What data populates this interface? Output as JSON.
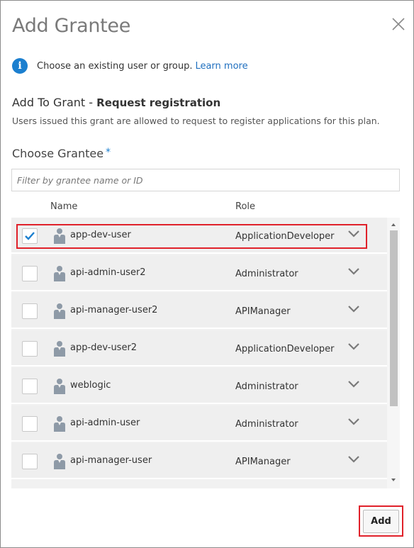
{
  "dialog": {
    "title": "Add Grantee",
    "close_icon": "close-icon"
  },
  "info": {
    "icon": "info-icon",
    "text": "Choose an existing user or group.",
    "link": "Learn more"
  },
  "grant": {
    "prefix": "Add To Grant -",
    "name": "Request registration",
    "description": "Users issued this grant are allowed to request to register applications for this plan."
  },
  "chooser": {
    "label": "Choose Grantee",
    "required_mark": "*",
    "filter_placeholder": "Filter by grantee name or ID",
    "columns": {
      "name": "Name",
      "role": "Role"
    }
  },
  "rows": [
    {
      "name": "app-dev-user",
      "role": "ApplicationDeveloper",
      "checked": true
    },
    {
      "name": "api-admin-user2",
      "role": "Administrator",
      "checked": false
    },
    {
      "name": "api-manager-user2",
      "role": "APIManager",
      "checked": false
    },
    {
      "name": "app-dev-user2",
      "role": "ApplicationDeveloper",
      "checked": false
    },
    {
      "name": "weblogic",
      "role": "Administrator",
      "checked": false
    },
    {
      "name": "api-admin-user",
      "role": "Administrator",
      "checked": false
    },
    {
      "name": "api-manager-user",
      "role": "APIManager",
      "checked": false
    }
  ],
  "actions": {
    "add_label": "Add"
  },
  "colors": {
    "accent": "#1b7fcf",
    "highlight": "#e0212a",
    "row_bg": "#efefef",
    "link": "#1f6fbf"
  }
}
